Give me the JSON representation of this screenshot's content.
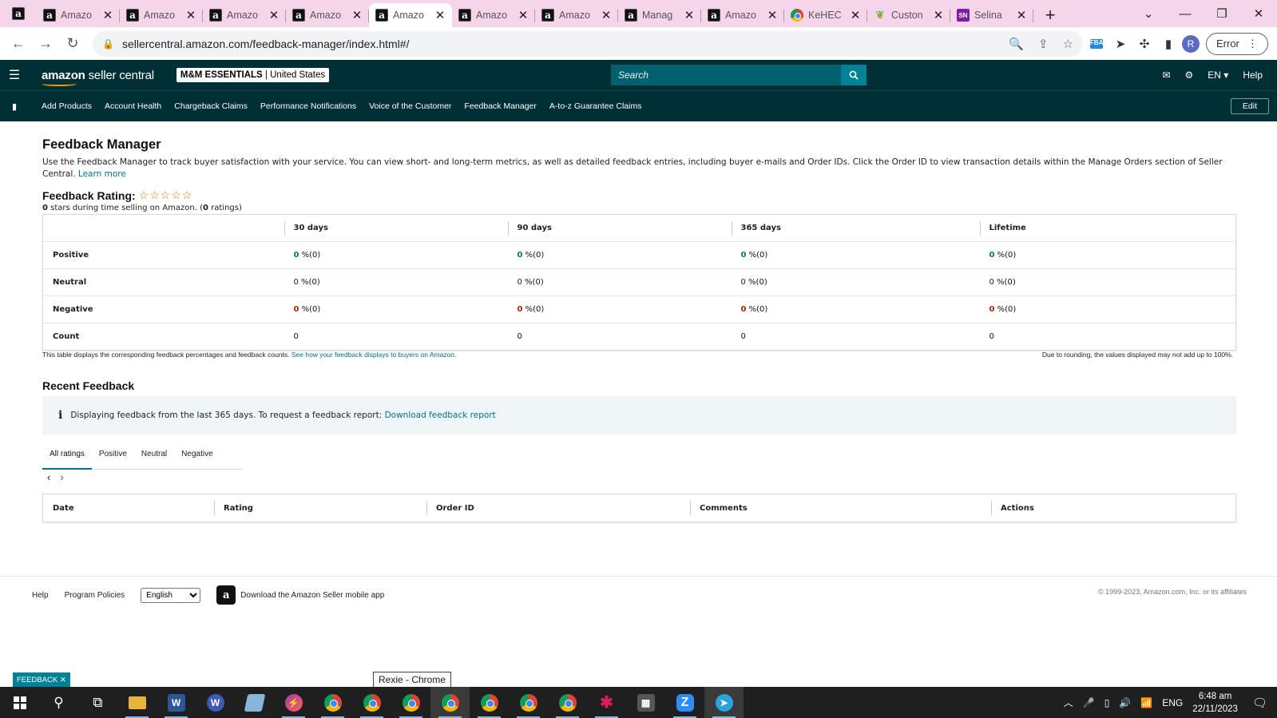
{
  "browser": {
    "tabs": [
      {
        "title": "Amazo",
        "icon": "amazon-icon",
        "active": false
      },
      {
        "title": "Amazo",
        "icon": "amazon-icon",
        "active": false
      },
      {
        "title": "Amazo",
        "icon": "amazon-icon",
        "active": false
      },
      {
        "title": "Amazo",
        "icon": "amazon-icon",
        "active": false
      },
      {
        "title": "Amazo",
        "icon": "amazon-icon",
        "active": true
      },
      {
        "title": "Amazo",
        "icon": "amazon-icon",
        "active": false
      },
      {
        "title": "Amazo",
        "icon": "amazon-icon",
        "active": false
      },
      {
        "title": "Manag",
        "icon": "amazon-icon",
        "active": false
      },
      {
        "title": "Amazo",
        "icon": "amazon-icon",
        "active": false
      },
      {
        "title": "KeHEC",
        "icon": "chrome-icon",
        "active": false
      },
      {
        "title": "Custon",
        "icon": "leaf-icon",
        "active": false
      },
      {
        "title": "Selina",
        "icon": "sn-icon",
        "active": false
      }
    ],
    "url": "sellercentral.amazon.com/feedback-manager/index.html#/",
    "profile_initial": "R",
    "error_label": "Error"
  },
  "header": {
    "logo_brand": "amazon",
    "logo_product": " seller central",
    "store_name": "M&M ESSENTIALS",
    "store_region": " | United States",
    "search_placeholder": "Search",
    "language": "EN ▾",
    "help": "Help"
  },
  "nav": {
    "items": [
      "Add Products",
      "Account Health",
      "Chargeback Claims",
      "Performance Notifications",
      "Voice of the Customer",
      "Feedback Manager",
      "A-to-z Guarantee Claims"
    ],
    "edit_label": "Edit"
  },
  "page": {
    "title": "Feedback Manager",
    "intro": "Use the Feedback Manager to track buyer satisfaction with your service. You can view short- and long-term metrics, as well as detailed feedback entries, including buyer e-mails and Order IDs. Click the Order ID to view transaction details within the Manage Orders section of Seller Central.",
    "learn_more": "Learn more",
    "rating_label": "Feedback Rating:",
    "stars": "☆☆☆☆☆",
    "rating_stars": "0",
    "rating_mid": " stars during time selling on Amazon. (",
    "rating_count": "0",
    "rating_end": " ratings)"
  },
  "feedback_table": {
    "columns": [
      "30 days",
      "90 days",
      "365 days",
      "Lifetime"
    ],
    "rows": [
      {
        "label": "Positive",
        "cells": [
          "0",
          "0",
          "0",
          "0"
        ]
      },
      {
        "label": "Neutral",
        "cells": [
          "0",
          "0",
          "0",
          "0"
        ]
      },
      {
        "label": "Negative",
        "cells": [
          "0",
          "0",
          "0",
          "0"
        ]
      }
    ],
    "pct_suffix": " %(0)",
    "count_label": "Count",
    "counts": [
      "0",
      "0",
      "0",
      "0"
    ],
    "note": "This table displays the corresponding feedback percentages and feedback counts. ",
    "note_link": "See how your feedback displays to buyers on Amazon.",
    "rounding_note": "Due to rounding, the values displayed may not add up to 100%."
  },
  "recent": {
    "title": "Recent Feedback",
    "info_text": "Displaying feedback from the last 365 days. To request a feedback report: ",
    "info_link": "Download feedback report",
    "tabs": [
      "All ratings",
      "Positive",
      "Neutral",
      "Negative"
    ],
    "columns": [
      "Date",
      "Rating",
      "Order ID",
      "Comments",
      "Actions"
    ]
  },
  "footer": {
    "help": "Help",
    "policies": "Program Policies",
    "language": "English",
    "app_link": "Download the Amazon Seller mobile app",
    "copyright": "© 1999-2023, Amazon.com, Inc. or its affiliates",
    "feedback_tab": "FEEDBACK ✕",
    "tooltip": "Rexie - Chrome"
  },
  "taskbar": {
    "lang": "ENG",
    "time": "6:48 am",
    "date": "22/11/2023"
  }
}
